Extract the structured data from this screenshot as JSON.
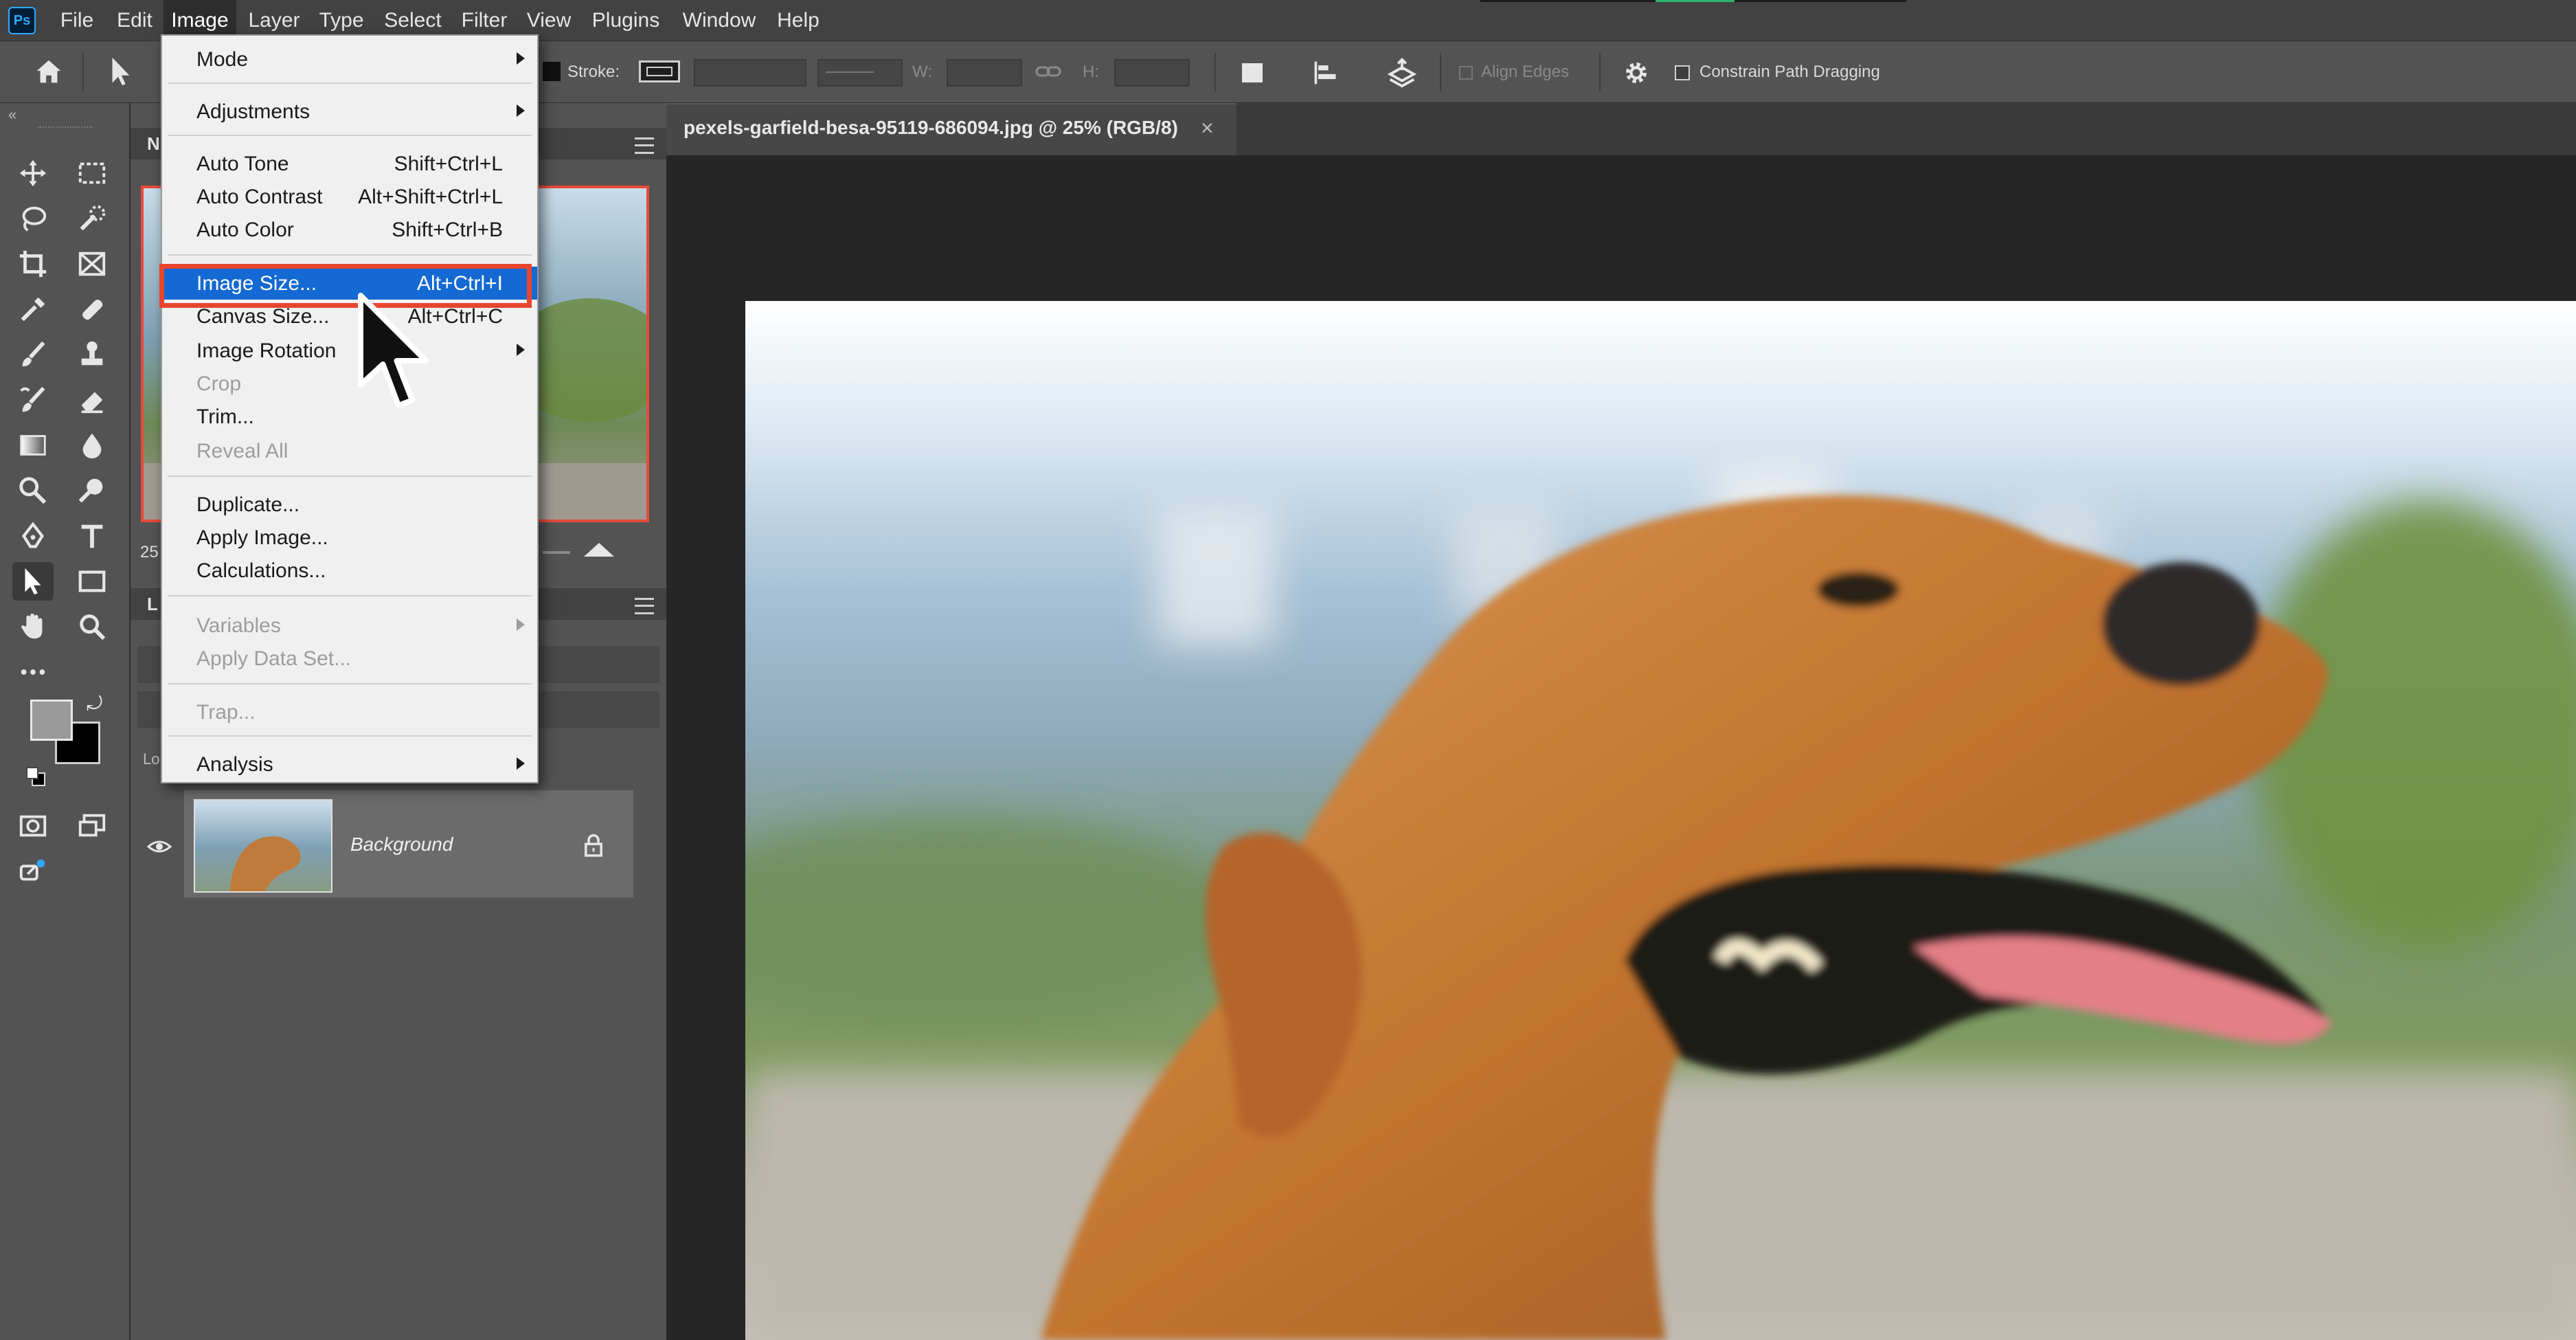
{
  "app": {
    "logo": "Ps"
  },
  "menubar": {
    "items": [
      {
        "label": "File"
      },
      {
        "label": "Edit"
      },
      {
        "label": "Image"
      },
      {
        "label": "Layer"
      },
      {
        "label": "Type"
      },
      {
        "label": "Select"
      },
      {
        "label": "Filter"
      },
      {
        "label": "View"
      },
      {
        "label": "Plugins"
      },
      {
        "label": "Window"
      },
      {
        "label": "Help"
      }
    ],
    "active": "Image"
  },
  "options_bar": {
    "stroke_label": "Stroke:",
    "w_label": "W:",
    "h_label": "H:",
    "align_edges_label": "Align Edges",
    "constrain_label": "Constrain Path Dragging"
  },
  "image_menu": {
    "items": [
      {
        "label": "Mode",
        "submenu": true
      },
      {
        "label": "Adjustments",
        "submenu": true
      },
      {
        "label": "Auto Tone",
        "shortcut": "Shift+Ctrl+L"
      },
      {
        "label": "Auto Contrast",
        "shortcut": "Alt+Shift+Ctrl+L"
      },
      {
        "label": "Auto Color",
        "shortcut": "Shift+Ctrl+B"
      },
      {
        "label": "Image Size...",
        "shortcut": "Alt+Ctrl+I",
        "highlighted": true
      },
      {
        "label": "Canvas Size...",
        "shortcut": "Alt+Ctrl+C"
      },
      {
        "label": "Image Rotation",
        "submenu": true
      },
      {
        "label": "Crop",
        "disabled": true
      },
      {
        "label": "Trim..."
      },
      {
        "label": "Reveal All",
        "disabled": true
      },
      {
        "label": "Duplicate..."
      },
      {
        "label": "Apply Image..."
      },
      {
        "label": "Calculations..."
      },
      {
        "label": "Variables",
        "submenu": true,
        "disabled": true
      },
      {
        "label": "Apply Data Set...",
        "disabled": true
      },
      {
        "label": "Trap...",
        "disabled": true
      },
      {
        "label": "Analysis",
        "submenu": true
      }
    ]
  },
  "panels": {
    "navigator_tab_partial": "N",
    "zoom_partial": "25",
    "layers_tab_partial": "L",
    "lock_partial": "Lo",
    "layer": {
      "name": "Background"
    }
  },
  "document": {
    "tab_title": "pexels-garfield-besa-95119-686094.jpg @ 25% (RGB/8)",
    "close_glyph": "×"
  },
  "colors": {
    "accent": "#1469d2",
    "highlight_outline": "#e8452f",
    "foreground_swatch": "#9a9a9a",
    "background_swatch": "#000000"
  }
}
